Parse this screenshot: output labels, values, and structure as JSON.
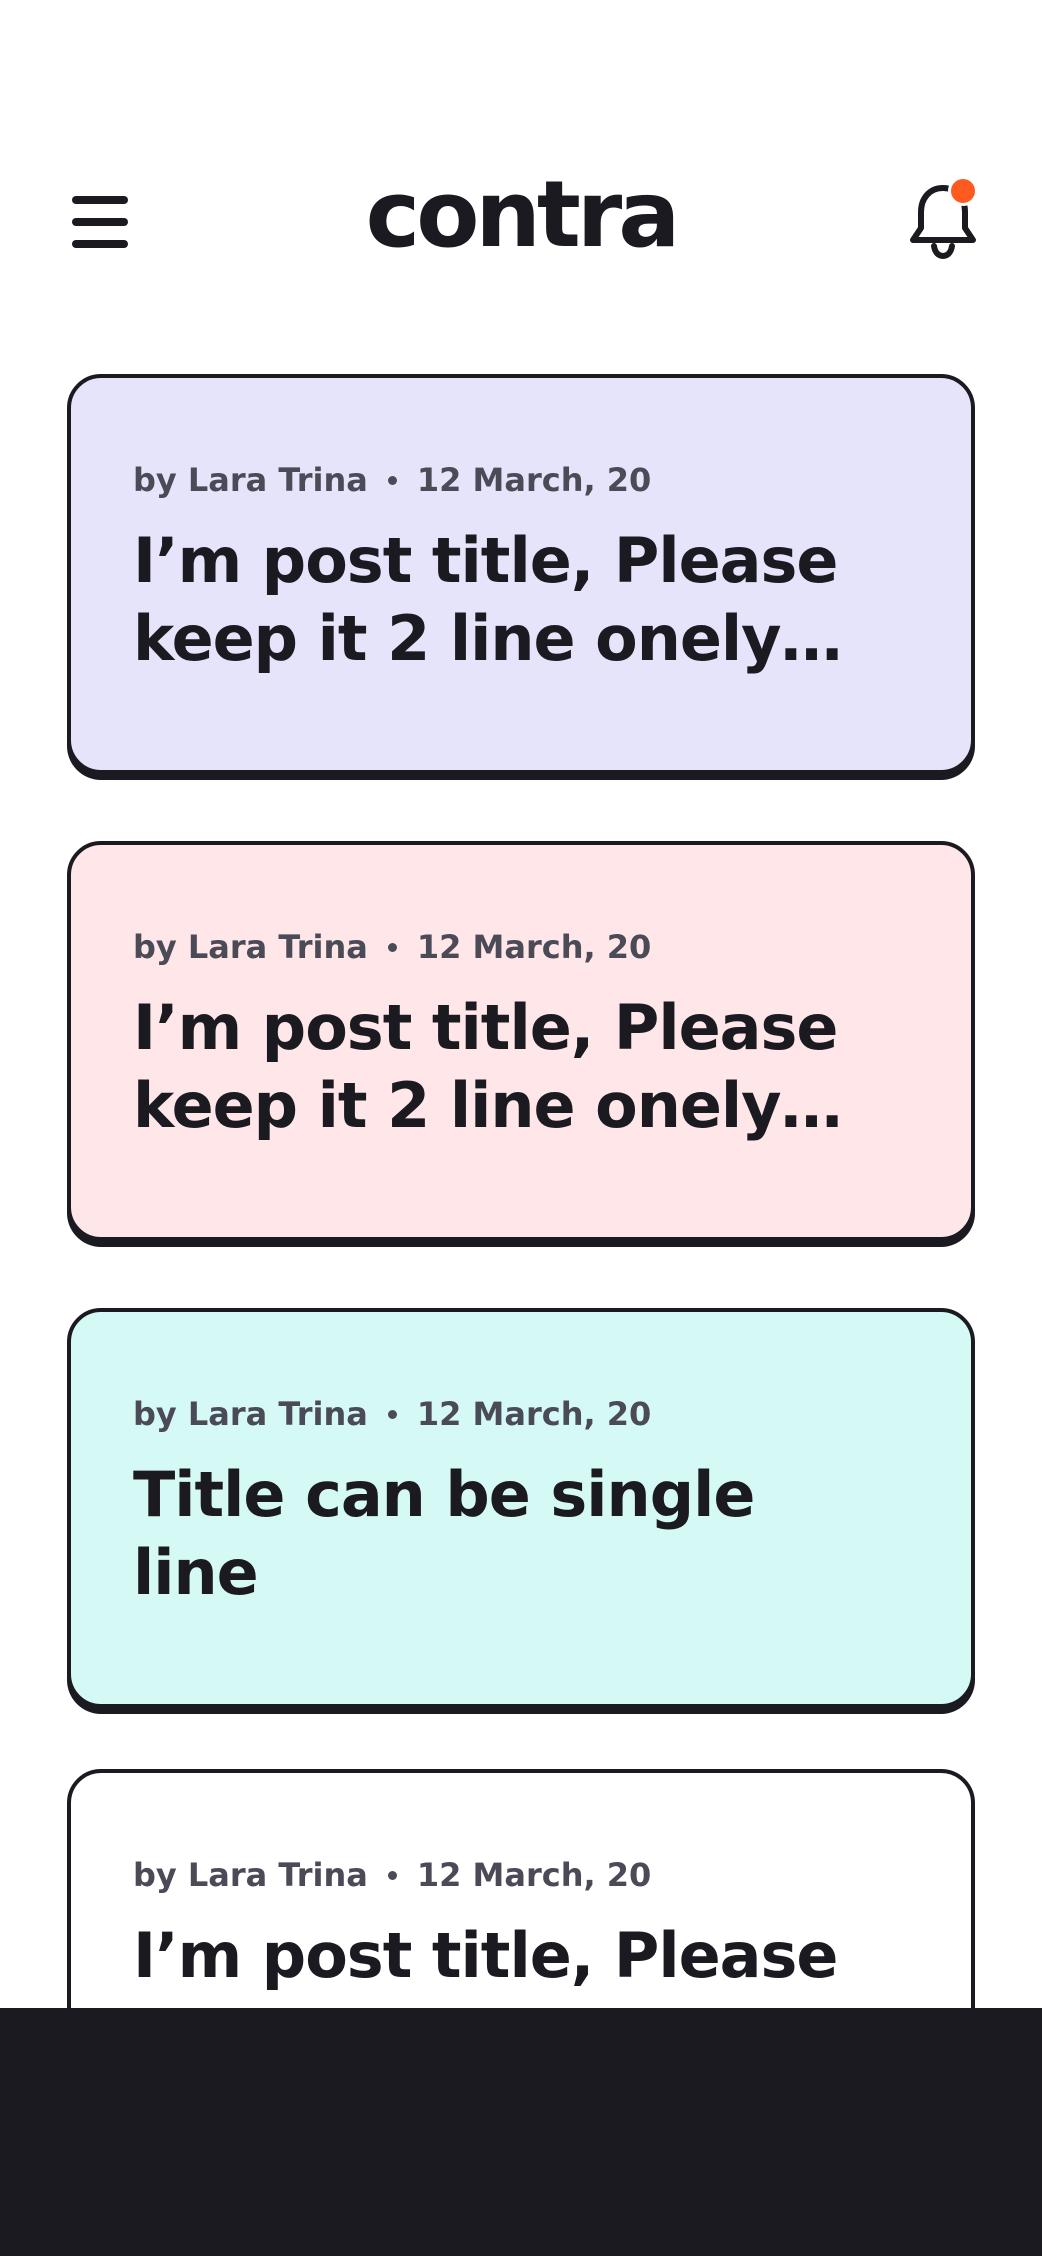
{
  "header": {
    "logo": "contra",
    "menu_icon": "hamburger-menu-icon",
    "notification_icon": "bell-icon",
    "notification_dot_color": "#ff5a1f"
  },
  "posts": [
    {
      "author": "by Lara Trina",
      "date": "12 March, 20",
      "title": "I’m post title, Please\nkeep it 2 line onely…",
      "bg_color": "#e6e4fa"
    },
    {
      "author": "by Lara Trina",
      "date": "12 March, 20",
      "title": "I’m post title, Please\nkeep it 2 line onely…",
      "bg_color": "#ffe6e8"
    },
    {
      "author": "by Lara Trina",
      "date": "12 March, 20",
      "title": "Title can be single\nline",
      "bg_color": "#d5faf5"
    },
    {
      "author": "by Lara Trina",
      "date": "12 March, 20",
      "title": "I’m post title, Please",
      "bg_color": "#ffffff"
    }
  ],
  "colors": {
    "ink": "#1b1a21",
    "meta_text": "#4b4a57",
    "bottom_bar": "#1b1a21"
  }
}
